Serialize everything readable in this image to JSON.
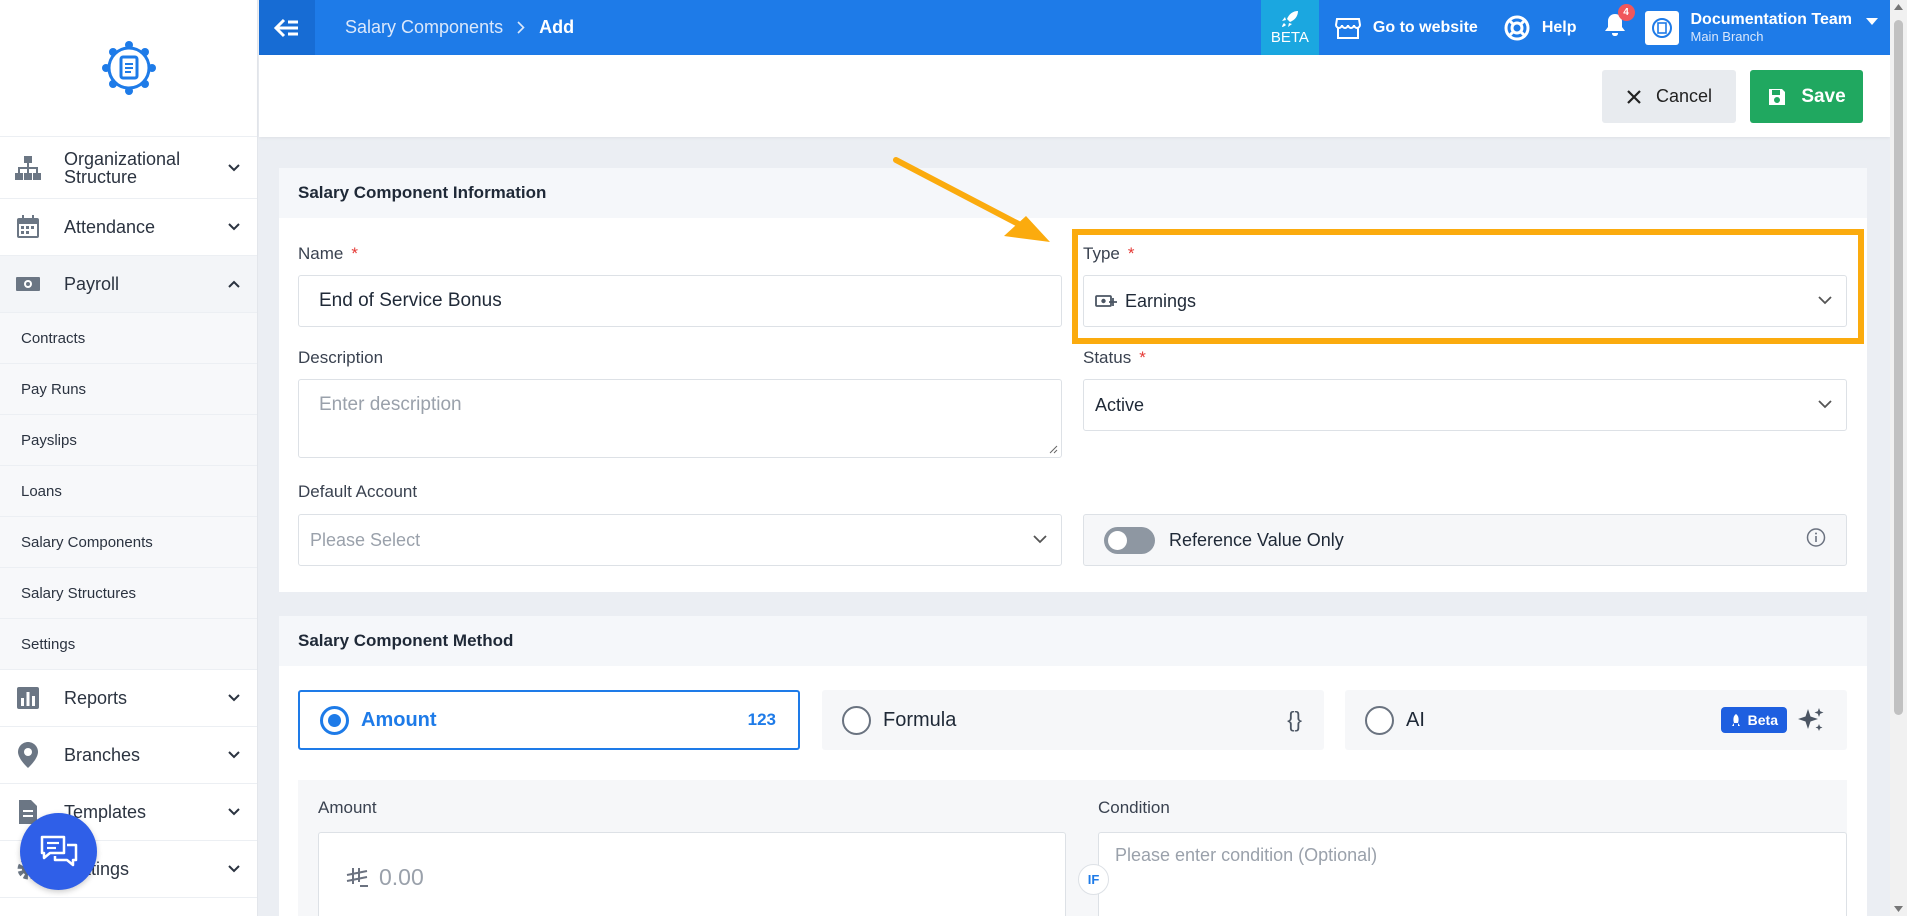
{
  "topbar": {
    "breadcrumb": [
      "Salary Components",
      "Add"
    ],
    "beta_label": "BETA",
    "go_to_website": "Go to website",
    "help": "Help",
    "notification_count": "4",
    "user_name": "Documentation Team",
    "user_branch": "Main Branch",
    "color": "#1e7be8"
  },
  "sidebar": {
    "items": [
      {
        "label": "Organizational Structure",
        "icon": "org-chart-icon"
      },
      {
        "label": "Attendance",
        "icon": "calendar-icon"
      },
      {
        "label": "Payroll",
        "icon": "money-icon",
        "expanded": true
      },
      {
        "label": "Reports",
        "icon": "bar-chart-icon"
      },
      {
        "label": "Branches",
        "icon": "location-pin-icon"
      },
      {
        "label": "Templates",
        "icon": "document-icon"
      },
      {
        "label": "Settings",
        "icon": "gear-icon"
      }
    ],
    "payroll_subitems": [
      "Contracts",
      "Pay Runs",
      "Payslips",
      "Loans",
      "Salary Components",
      "Salary Structures",
      "Settings"
    ]
  },
  "actions": {
    "cancel": "Cancel",
    "save": "Save",
    "save_color": "#20a860"
  },
  "info_section": {
    "title": "Salary Component Information",
    "name_label": "Name",
    "name_value": "End of Service Bonus",
    "type_label": "Type",
    "type_value": "Earnings",
    "description_label": "Description",
    "description_placeholder": "Enter description",
    "status_label": "Status",
    "status_value": "Active",
    "default_account_label": "Default Account",
    "default_account_placeholder": "Please Select",
    "reference_value_label": "Reference Value Only"
  },
  "method_section": {
    "title": "Salary Component Method",
    "options": [
      {
        "label": "Amount",
        "badge": "123",
        "selected": true
      },
      {
        "label": "Formula",
        "badge": "{}",
        "selected": false
      },
      {
        "label": "AI",
        "badge": "Beta",
        "selected": false
      }
    ],
    "amount_label": "Amount",
    "amount_value": "0.00",
    "condition_label": "Condition",
    "condition_placeholder": "Please enter condition (Optional)",
    "if_label": "IF"
  },
  "annotation": {
    "highlight_color": "#fbab0e"
  }
}
